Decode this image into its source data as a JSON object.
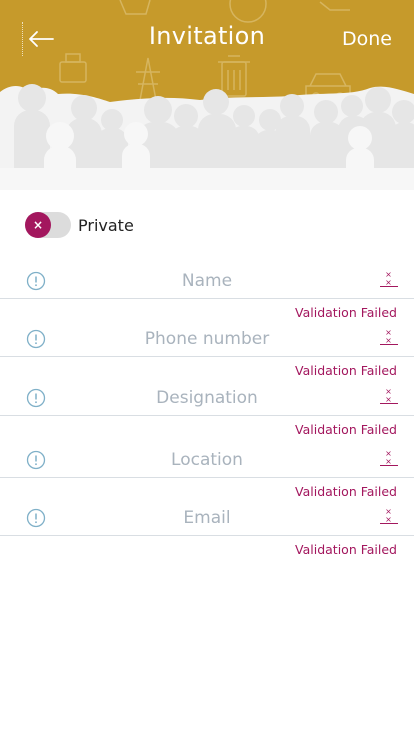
{
  "header": {
    "title": "Invitation",
    "done_label": "Done",
    "back_icon": "arrow-left-icon",
    "background_color": "#c69a2b"
  },
  "privacy_toggle": {
    "label": "Private",
    "state": "off",
    "knob_glyph": "×",
    "accent_color": "#a3175e"
  },
  "form": {
    "fields": [
      {
        "placeholder": "Name",
        "value": "",
        "error": "Validation Failed",
        "clear_glyph": "× ×"
      },
      {
        "placeholder": "Phone number",
        "value": "",
        "error": "Validation Failed",
        "clear_glyph": "× ×"
      },
      {
        "placeholder": "Designation",
        "value": "",
        "error": "Validation Failed",
        "clear_glyph": "× ×"
      },
      {
        "placeholder": "Location",
        "value": "",
        "error": "Validation Failed",
        "clear_glyph": "× ×"
      },
      {
        "placeholder": "Email",
        "value": "",
        "error": "Validation Failed",
        "clear_glyph": "× ×"
      }
    ]
  },
  "colors": {
    "error": "#a3175e",
    "icon": "#7fb0c8",
    "placeholder": "#a9b3bd"
  }
}
